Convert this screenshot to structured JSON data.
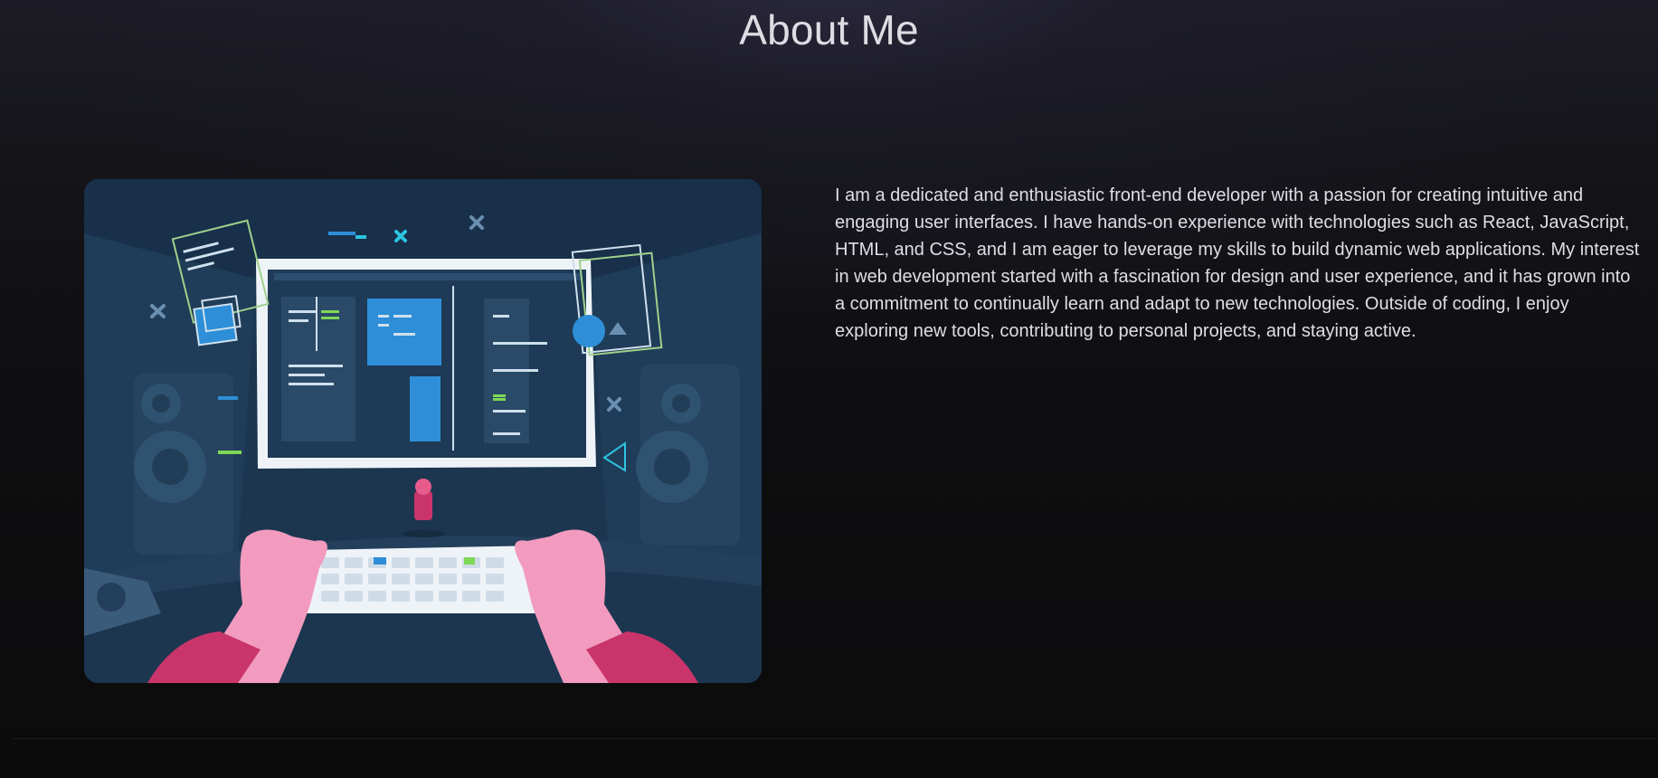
{
  "about": {
    "title": "About Me",
    "paragraph": "I am a dedicated and enthusiastic front-end developer with a passion for creating intuitive and engaging user interfaces. I have hands-on experience with technologies such as React, JavaScript, HTML, and CSS, and I am eager to leverage my skills to build dynamic web applications. My interest in web development started with a fascination for design and user experience, and it has grown into a commitment to continually learn and adapt to new technologies. Outside of coding, I enjoy exploring new tools, contributing to personal projects, and staying active.",
    "illustration": {
      "subject": "developer-workstation",
      "colors": {
        "background": "#1c3650",
        "panel": "#2a4a68",
        "screen_frame": "#eef3f8",
        "accent_blue": "#2e8fd8",
        "accent_green": "#7ed957",
        "hands": "#f29bbf",
        "sleeves": "#c9356a"
      }
    }
  },
  "theme": {
    "page_background": "#0b0b0c",
    "title_color": "#dcdce2",
    "text_color": "#dedee4"
  }
}
